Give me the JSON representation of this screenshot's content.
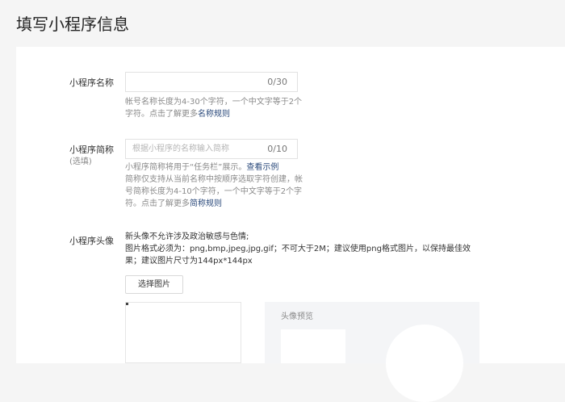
{
  "page": {
    "title": "填写小程序信息"
  },
  "name_field": {
    "label": "小程序名称",
    "counter": "0/30",
    "hint_text": "帐号名称长度为4-30个字符，一个中文字等于2个字符。点击了解更多",
    "hint_link": "名称规则"
  },
  "short_name_field": {
    "label": "小程序简称",
    "label_sub": "(选填)",
    "placeholder": "根据小程序的名称输入简称",
    "counter": "0/10",
    "hint_text_1": "小程序简称将用于“任务栏”展示。",
    "hint_link_1": "查看示例",
    "hint_text_2": "简称仅支持从当前名称中按顺序选取字符创建，帐号简称长度为4-10个字符，一个中文字等于2个字符。点击了解更多",
    "hint_link_2": "简称规则"
  },
  "avatar_field": {
    "label": "小程序头像",
    "desc_1": "新头像不允许涉及政治敏感与色情;",
    "desc_2": "图片格式必须为：png,bmp,jpeg,jpg,gif；不可大于2M；建议使用png格式图片，以保持最佳效果；建议图片尺寸为144px*144px",
    "select_button": "选择图片",
    "preview_title": "头像预览"
  }
}
